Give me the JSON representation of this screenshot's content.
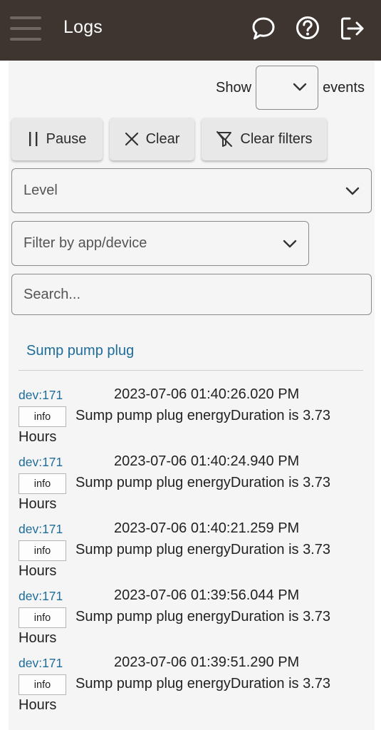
{
  "header": {
    "title": "Logs",
    "icons": [
      "menu-icon",
      "chat-bubble-icon",
      "help-circle-icon",
      "logout-icon"
    ]
  },
  "show": {
    "label_before": "Show",
    "selected": "",
    "label_after": "events"
  },
  "toolbar": {
    "pause_label": "Pause",
    "clear_label": "Clear",
    "clear_filters_label": "Clear filters"
  },
  "filters": {
    "level_placeholder": "Level",
    "app_device_placeholder": "Filter by app/device",
    "search_placeholder": "Search..."
  },
  "device_filter_link": "Sump pump plug",
  "logs": [
    {
      "source": "dev:171",
      "timestamp": "2023-07-06 01:40:26.020 PM",
      "level": "info",
      "message": "Sump pump plug energyDuration is 3.73",
      "message_cont": "Hours"
    },
    {
      "source": "dev:171",
      "timestamp": "2023-07-06 01:40:24.940 PM",
      "level": "info",
      "message": "Sump pump plug energyDuration is 3.73",
      "message_cont": "Hours"
    },
    {
      "source": "dev:171",
      "timestamp": "2023-07-06 01:40:21.259 PM",
      "level": "info",
      "message": "Sump pump plug energyDuration is 3.73",
      "message_cont": "Hours"
    },
    {
      "source": "dev:171",
      "timestamp": "2023-07-06 01:39:56.044 PM",
      "level": "info",
      "message": "Sump pump plug energyDuration is 3.73",
      "message_cont": "Hours"
    },
    {
      "source": "dev:171",
      "timestamp": "2023-07-06 01:39:51.290 PM",
      "level": "info",
      "message": "Sump pump plug energyDuration is 3.73",
      "message_cont": "Hours"
    }
  ],
  "colors": {
    "appbar": "#3e3430",
    "link": "#1d6c9a",
    "panel": "#f5f5f5",
    "button": "#e8e8e8"
  }
}
